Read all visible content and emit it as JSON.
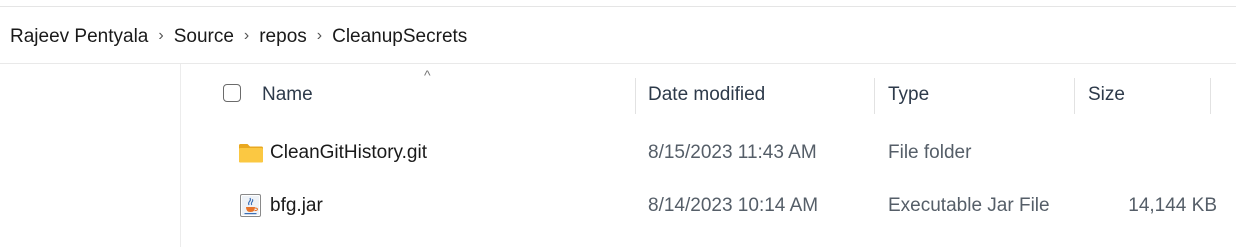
{
  "breadcrumb": {
    "items": [
      "Rajeev Pentyala",
      "Source",
      "repos",
      "CleanupSecrets"
    ],
    "separator": "›"
  },
  "columns": {
    "name": "Name",
    "date": "Date modified",
    "type": "Type",
    "size": "Size",
    "sort_indicator": "^"
  },
  "rows": [
    {
      "name": "CleanGitHistory.git",
      "date": "8/15/2023 11:43 AM",
      "type": "File folder",
      "size": "",
      "icon": "folder-icon"
    },
    {
      "name": "bfg.jar",
      "date": "8/14/2023 10:14 AM",
      "type": "Executable Jar File",
      "size": "14,144 KB",
      "icon": "java-jar-icon"
    }
  ],
  "colors": {
    "folder": "#F8C23C",
    "accent_text": "#2d3a4a"
  }
}
